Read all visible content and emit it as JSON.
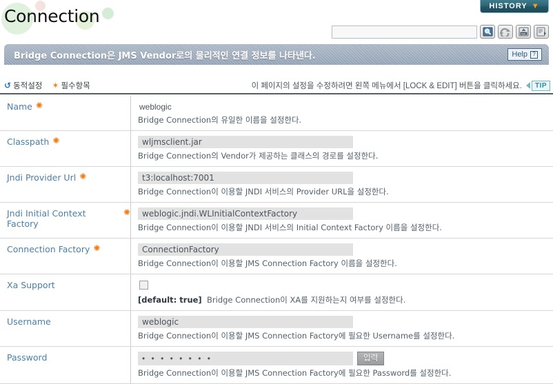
{
  "header": {
    "title": "Connection",
    "history_label": "HISTORY",
    "history_chevron": "chevron-down-icon",
    "search_value": "",
    "search_placeholder": "",
    "tool_icons": [
      {
        "name": "search-icon",
        "title": "Search"
      },
      {
        "name": "refresh-icon",
        "title": "Refresh"
      },
      {
        "name": "xml-export-icon",
        "title": "XML"
      },
      {
        "name": "save-export-icon",
        "title": "Export"
      }
    ]
  },
  "banner": {
    "text": "Bridge Connection은 JMS Vendor로의 물리적인 연결 정보를 나타낸다.",
    "help_label": "Help",
    "help_mark": "?"
  },
  "legend": {
    "dynamic_label": "동적설정",
    "required_label": "필수항목",
    "tip_text": "이 페이지의 설정을 수정하려면 왼쪽 메뉴에서 [LOCK & EDIT] 버튼을 클릭하세요.",
    "tip_tag": "TIP"
  },
  "form": {
    "rows": [
      {
        "label": "Name",
        "required": true,
        "type": "text",
        "value": "weblogic",
        "desc": "Bridge Connection의 유일한 이름을 설정한다."
      },
      {
        "label": "Classpath",
        "required": true,
        "type": "input",
        "value": "wljmsclient.jar",
        "desc": "Bridge Connection의 Vendor가 제공하는 클래스의 경로를 설정한다."
      },
      {
        "label": "Jndi Provider Url",
        "required": true,
        "type": "input",
        "value": "t3:localhost:7001",
        "desc": "Bridge Connection이 이용할 JNDI 서비스의 Provider URL을 설정한다."
      },
      {
        "label": "Jndi Initial Context Factory",
        "required": true,
        "type": "input",
        "value": "weblogic.jndi.WLInitialContextFactory",
        "desc": "Bridge Connection이 이용할 JNDI 서비스의 Initial Context Factory 이름을 설정한다."
      },
      {
        "label": "Connection Factory",
        "required": true,
        "type": "input",
        "value": "ConnectionFactory",
        "desc": "Bridge Connection이 이용할 JMS Connection Factory 이름을 설정한다."
      },
      {
        "label": "Xa Support",
        "required": false,
        "type": "checkbox",
        "checked": false,
        "desc_prefix": "[default: true]",
        "desc": "Bridge Connection이 XA를 지원하는지 여부를 설정한다."
      },
      {
        "label": "Username",
        "required": false,
        "type": "input",
        "value": "weblogic",
        "desc": "Bridge Connection이 이용할 JMS Connection Factory에 필요한 Username를 설정한다."
      },
      {
        "label": "Password",
        "required": false,
        "type": "password",
        "value": "• • • • • • • •",
        "button_label": "입력",
        "desc": "Bridge Connection이 이용할 JMS Connection Factory에 필요한 Password를 설정한다."
      }
    ]
  },
  "colors": {
    "label_blue": "#4a7fa8",
    "required_orange": "#f07c15",
    "banner_grey_blue": "#9fadbd",
    "history_teal": "#2f6676",
    "tip_teal": "#2d8c9e"
  }
}
